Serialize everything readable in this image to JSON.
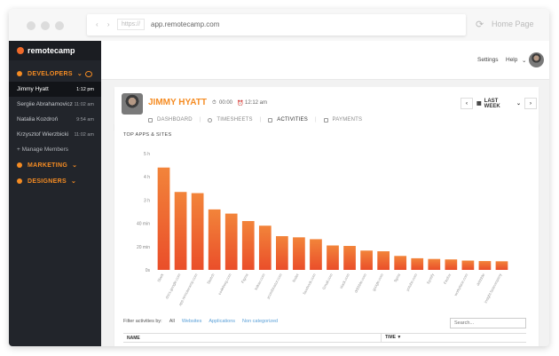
{
  "browser": {
    "scheme": "https://",
    "url": "app.remotecamp.com",
    "home_label": "Home Page"
  },
  "app": {
    "logo_text": "remotecamp"
  },
  "sidebar": {
    "groups": [
      {
        "label": "DEVELOPERS"
      },
      {
        "label": "MARKETING"
      },
      {
        "label": "DESIGNERS"
      }
    ],
    "members": [
      {
        "name": "Jimmy Hyatt",
        "time": "1:12 pm"
      },
      {
        "name": "Sergiie Abrahamovicz",
        "time": "11:02 am"
      },
      {
        "name": "Natalia Kozdroń",
        "time": "9:54 am"
      },
      {
        "name": "Krzysztof Wierzbicki",
        "time": "11:02 am"
      }
    ],
    "manage_label": "+ Manage Members"
  },
  "topbar": {
    "settings": "Settings",
    "help": "Help"
  },
  "user": {
    "name": "JIMMY HYATT",
    "duration": "00:00",
    "clock": "12:12 am"
  },
  "tabs": [
    "DASHBOARD",
    "TIMESHEETS",
    "ACTIVITIES",
    "PAYMENTS"
  ],
  "period": {
    "label": "LAST WEEK",
    "prev": "‹",
    "next": "›"
  },
  "chart_data": {
    "type": "bar",
    "title": "TOP APPS & SITES",
    "yticks": [
      "5 h",
      "4 h",
      "3 h",
      "40 min",
      "20 min",
      "0s"
    ],
    "ylim": [
      0,
      5
    ],
    "categories": [
      "Slack",
      "docs.google.com",
      "app.remotecamp.com",
      "Sketch",
      "codeberg.com",
      "Figma",
      "kakao.com",
      "ycombinator.com",
      "finder",
      "facebook.com",
      "Gmail.com",
      "slack.com",
      "dribbble.com",
      "google.com",
      "figma",
      "yotube.com",
      "Spotify",
      "Firefox",
      "workplace.com",
      "dribbble",
      "insight.fastcompany"
    ],
    "values": [
      4.4,
      3.35,
      3.3,
      2.6,
      2.42,
      2.1,
      1.9,
      1.45,
      1.4,
      1.32,
      1.05,
      1.03,
      0.83,
      0.8,
      0.6,
      0.5,
      0.47,
      0.45,
      0.4,
      0.38,
      0.37
    ],
    "colors": {
      "top": "#f2843a",
      "bottom": "#ea4e2a"
    }
  },
  "filters": {
    "label": "Filter activities by:",
    "options": [
      "All",
      "Websites",
      "Applications",
      "Non categorized"
    ]
  },
  "search": {
    "placeholder": "Search..."
  },
  "table": {
    "columns": [
      "NAME",
      "TIME ▼"
    ]
  }
}
